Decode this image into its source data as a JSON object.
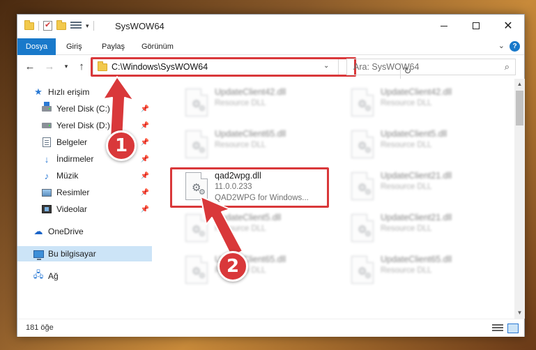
{
  "window": {
    "title": "SysWOW64",
    "minimize_icon": "minimize-icon",
    "maximize_icon": "maximize-icon",
    "close_icon": "close-icon"
  },
  "ribbon": {
    "tabs": [
      "Dosya",
      "Giriş",
      "Paylaş",
      "Görünüm"
    ],
    "help_icon": "help-icon",
    "help_glyph": "?"
  },
  "navbar": {
    "address": "C:\\Windows\\SysWOW64",
    "search_placeholder": "Ara: SysWOW64"
  },
  "sidebar": {
    "items": [
      {
        "label": "Hızlı erişim",
        "icon": "star-icon",
        "pinned": false
      },
      {
        "label": "Yerel Disk (C:)",
        "icon": "drive-icon",
        "pinned": true
      },
      {
        "label": "Yerel Disk (D:)",
        "icon": "drive-icon",
        "pinned": true
      },
      {
        "label": "Belgeler",
        "icon": "documents-icon",
        "pinned": true
      },
      {
        "label": "İndirmeler",
        "icon": "download-icon",
        "pinned": true
      },
      {
        "label": "Müzik",
        "icon": "music-icon",
        "pinned": true
      },
      {
        "label": "Resimler",
        "icon": "pictures-icon",
        "pinned": true
      },
      {
        "label": "Videolar",
        "icon": "videos-icon",
        "pinned": true
      },
      {
        "label": "OneDrive",
        "icon": "cloud-icon",
        "pinned": false
      },
      {
        "label": "Bu bilgisayar",
        "icon": "computer-icon",
        "pinned": false,
        "selected": true
      },
      {
        "label": "Ağ",
        "icon": "network-icon",
        "pinned": false
      }
    ]
  },
  "files": [
    {
      "name": "UpdateClient42.dll",
      "line2": "Resource DLL",
      "line3": "",
      "blurred": true
    },
    {
      "name": "UpdateClient42.dll",
      "line2": "Resource DLL",
      "line3": "",
      "blurred": true
    },
    {
      "name": "UpdateClient65.dll",
      "line2": "Resource DLL",
      "line3": "",
      "blurred": true
    },
    {
      "name": "UpdateClient5.dll",
      "line2": "Resource DLL",
      "line3": "",
      "blurred": true
    },
    {
      "name": "qad2wpg.dll",
      "line2": "11.0.0.233",
      "line3": "QAD2WPG for Windows...",
      "blurred": false
    },
    {
      "name": "UpdateClient21.dll",
      "line2": "Resource DLL",
      "line3": "",
      "blurred": true
    },
    {
      "name": "UpdateClient5.dll",
      "line2": "Resource DLL",
      "line3": "",
      "blurred": true
    },
    {
      "name": "UpdateClient21.dll",
      "line2": "Resource DLL",
      "line3": "",
      "blurred": true
    },
    {
      "name": "UpdateClient65.dll",
      "line2": "Resource DLL",
      "line3": "",
      "blurred": true
    },
    {
      "name": "UpdateClient65.dll",
      "line2": "Resource DLL",
      "line3": "",
      "blurred": true
    }
  ],
  "status": {
    "item_count": "181 öğe"
  },
  "annotations": {
    "step1": "1",
    "step2": "2",
    "color": "#d9383a"
  },
  "colors": {
    "accent": "#1979ca",
    "selection": "#cce4f7",
    "highlight": "#d9383a"
  }
}
